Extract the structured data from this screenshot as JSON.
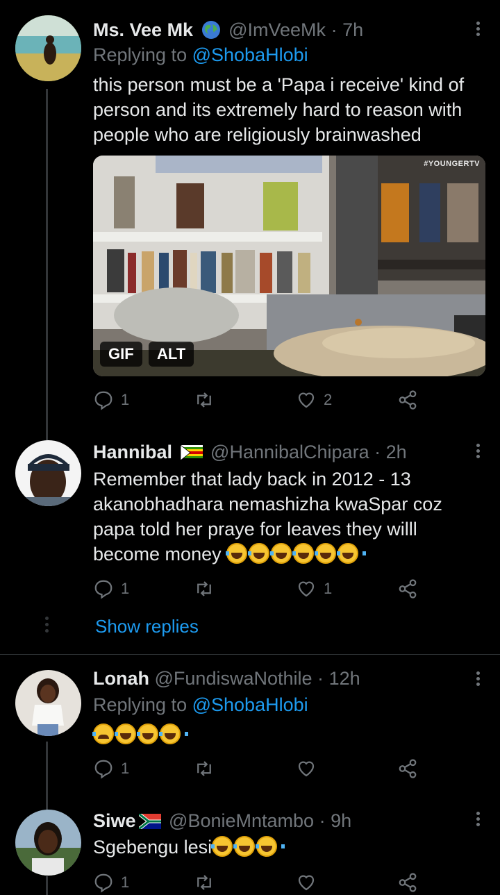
{
  "tweets": [
    {
      "name": "Ms. Vee Mk",
      "handle": "@ImVeeMk",
      "time": "7h",
      "replying_prefix": "Replying to",
      "replying_to": "@ShobaHlobi",
      "text": "this person must be a 'Papa i receive' kind of person and its extremely hard to reason with people who are religiously brainwashed",
      "media": {
        "watermark": "#YOUNGERTV",
        "gif_label": "GIF",
        "alt_label": "ALT"
      },
      "reply_count": "1",
      "retweet_count": "",
      "like_count": "2"
    },
    {
      "name": "Hannibal",
      "handle": "@HannibalChipara",
      "time": "2h",
      "text": "Remember that lady back in 2012 - 13 akanobhadhara nemashizha kwaSpar coz papa told her praye for leaves they willl become money",
      "reply_count": "1",
      "retweet_count": "",
      "like_count": "1"
    },
    {
      "name": "Lonah",
      "handle": "@FundiswaNothile",
      "time": "12h",
      "replying_prefix": "Replying to",
      "replying_to": "@ShobaHlobi",
      "reply_count": "1",
      "retweet_count": "",
      "like_count": ""
    },
    {
      "name": "Siwe",
      "handle": "@BonieMntambo",
      "time": "9h",
      "text": "Sgebengu lesi",
      "reply_count": "1",
      "retweet_count": "",
      "like_count": ""
    }
  ],
  "show_replies": "Show replies",
  "separator_dot": "·",
  "icons": {
    "reply": "reply-icon",
    "retweet": "retweet-icon",
    "like": "heart-icon",
    "share": "share-icon",
    "more": "more-vertical-icon",
    "verified_globe": "globe-icon",
    "emoji_laugh": "face-with-tears-of-joy",
    "emoji_cry": "loudly-crying-face",
    "flag_zw": "flag-zimbabwe",
    "flag_za": "flag-south-africa"
  },
  "colors": {
    "background": "#000000",
    "text": "#e7e9ea",
    "secondary": "#71767b",
    "link": "#1d9bf0",
    "divider": "#2f3336"
  }
}
